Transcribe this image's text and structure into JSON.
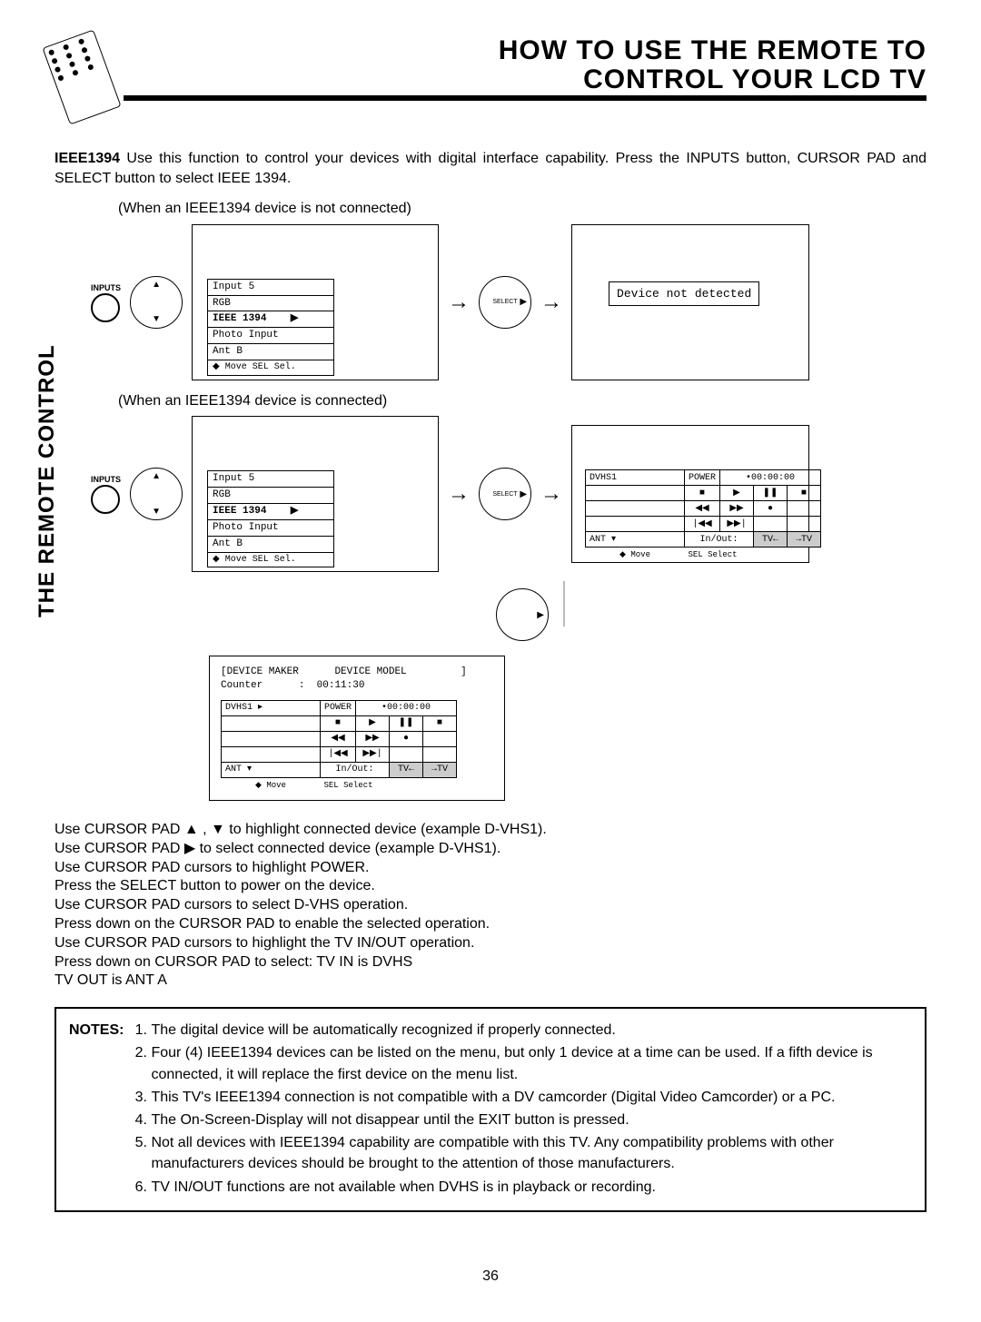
{
  "header": {
    "title_l1": "HOW TO  USE THE REMOTE TO",
    "title_l2": "CONTROL YOUR LCD TV"
  },
  "side_label": "THE REMOTE CONTROL",
  "intro": {
    "tag": "IEEE1394",
    "text": "Use this function to control your devices with digital interface capability.  Press the INPUTS button, CURSOR PAD and SELECT button to select IEEE 1394."
  },
  "states": {
    "not_connected_label": "(When an IEEE1394 device is not connected)",
    "connected_label": "(When an IEEE1394 device is connected)"
  },
  "inputs_label": "INPUTS",
  "dpad_center": "SELECT",
  "menu": {
    "items": [
      "Input 5",
      "RGB",
      "IEEE 1394",
      "Photo Input",
      "Ant B"
    ],
    "footer": "◆ Move  SEL Sel."
  },
  "device_not_detected": "Device not detected",
  "control_panel": {
    "device": "DVHS1",
    "power": "POWER",
    "counter": "•00:00:00",
    "transport_row": [
      "■",
      "▶",
      "❚❚",
      "■"
    ],
    "transport_row2": [
      "◀◀",
      "▶▶",
      "●"
    ],
    "transport_row3": [
      "|◀◀",
      "▶▶|"
    ],
    "ant": "ANT",
    "inout": "In/Out:",
    "inout_opts": [
      "TV←",
      "→TV"
    ],
    "footer_move": "◆ Move",
    "footer_select": "SEL Select"
  },
  "detail": {
    "maker": "[DEVICE MAKER",
    "model": "DEVICE MODEL",
    "bracket": "]",
    "counter_lbl": "Counter",
    "counter_val": "00:11:30"
  },
  "instructions": {
    "l1": "Use CURSOR PAD ▲ , ▼ to highlight connected device (example D-VHS1).",
    "l2": "Use CURSOR PAD ▶  to select connected device (example D-VHS1).",
    "l3": "Use CURSOR PAD cursors to highlight POWER.",
    "l4": "Press the SELECT button to power on the device.",
    "l5": "Use CURSOR PAD cursors to select D-VHS operation.",
    "l6": "Press down on the CURSOR PAD to enable the selected operation.",
    "l7": "Use CURSOR PAD cursors to highlight the TV IN/OUT operation.",
    "l8": "Press down on CURSOR PAD to select: TV IN is DVHS",
    "l9": "TV OUT is ANT A"
  },
  "notes": {
    "label": "NOTES:",
    "items": [
      "The digital device will be automatically recognized if properly connected.",
      "Four (4) IEEE1394 devices can be listed on the menu, but only 1 device at a time can be used.  If a fifth device is connected, it will replace the first device on the menu list.",
      "This TV's IEEE1394 connection is not compatible with a DV camcorder (Digital Video Camcorder) or a PC.",
      "The On-Screen-Display will not disappear until the EXIT button is pressed.",
      "Not all devices with IEEE1394 capability are compatible with this TV.  Any compatibility problems with other manufacturers devices should be brought to the attention of those manufacturers.",
      "TV IN/OUT functions are not available when DVHS is in playback or recording."
    ]
  },
  "page_number": "36"
}
